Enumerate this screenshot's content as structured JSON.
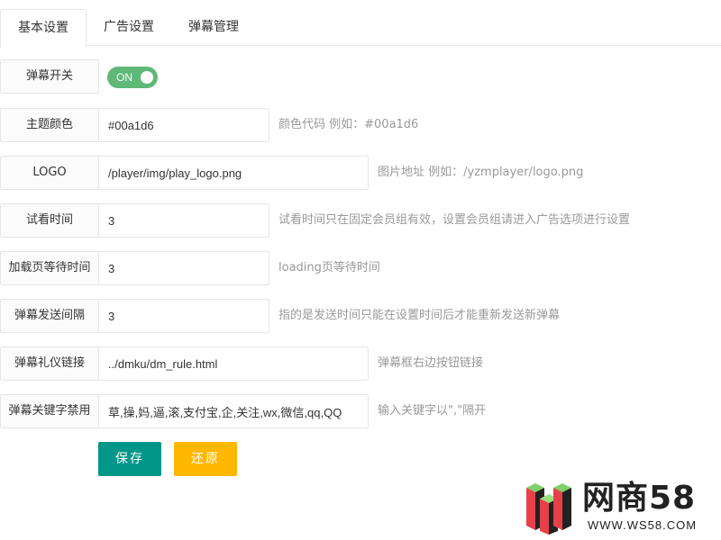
{
  "tabs": [
    {
      "label": "基本设置",
      "active": true
    },
    {
      "label": "广告设置",
      "active": false
    },
    {
      "label": "弹幕管理",
      "active": false
    }
  ],
  "form": {
    "danmaku_switch": {
      "label": "弹幕开关",
      "state_text": "ON",
      "on": true
    },
    "theme_color": {
      "label": "主题颜色",
      "value": "#00a1d6",
      "hint": "颜色代码 例如：#00a1d6"
    },
    "logo": {
      "label": "LOGO",
      "value": "/player/img/play_logo.png",
      "hint": "图片地址 例如：/yzmplayer/logo.png"
    },
    "trial_time": {
      "label": "试看时间",
      "value": "3",
      "hint": "试看时间只在固定会员组有效，设置会员组请进入广告选项进行设置"
    },
    "loading_wait": {
      "label": "加载页等待时间",
      "value": "3",
      "hint": "loading页等待时间"
    },
    "send_interval": {
      "label": "弹幕发送间隔",
      "value": "3",
      "hint": "指的是发送时间只能在设置时间后才能重新发送新弹幕"
    },
    "etiquette_link": {
      "label": "弹幕礼仪链接",
      "value": "../dmku/dm_rule.html",
      "hint": "弹幕框右边按钮链接"
    },
    "banned_keywords": {
      "label": "弹幕关键字禁用",
      "value": "草,操,妈,逼,滚,支付宝,企,关注,wx,微信,qq,QQ",
      "hint": "输入关键字以\",\"隔开"
    }
  },
  "buttons": {
    "save": "保存",
    "reset": "还原"
  },
  "colors": {
    "switch_on": "#5FB878",
    "save": "#009688",
    "reset": "#FFB800"
  },
  "watermark": {
    "text": "网商58",
    "url": "WWW.WS58.COM"
  }
}
